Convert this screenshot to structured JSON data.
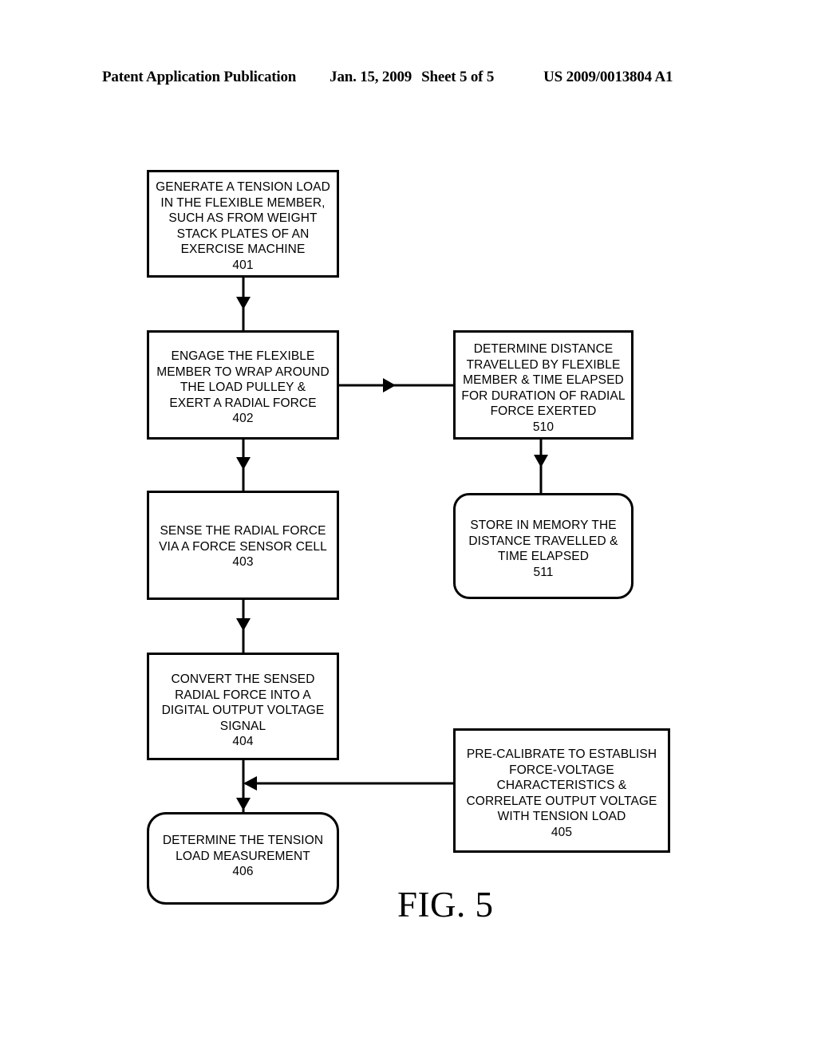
{
  "header": {
    "publication": "Patent Application Publication",
    "date": "Jan. 15, 2009",
    "sheet": "Sheet 5 of 5",
    "patent_number": "US 2009/0013804 A1"
  },
  "figure": {
    "caption": "FIG. 5"
  },
  "flowchart": {
    "boxes": [
      {
        "id": "401",
        "shape": "rectangle",
        "text": "GENERATE A TENSION LOAD\nIN THE FLEXIBLE MEMBER,\nSUCH AS FROM WEIGHT\nSTACK PLATES OF AN\nEXERCISE MACHINE\n401"
      },
      {
        "id": "402",
        "shape": "rectangle",
        "text": "ENGAGE THE FLEXIBLE\nMEMBER TO WRAP AROUND\nTHE LOAD PULLEY &\nEXERT A RADIAL FORCE\n402"
      },
      {
        "id": "510",
        "shape": "rectangle",
        "text": "DETERMINE DISTANCE\nTRAVELLED BY FLEXIBLE\nMEMBER & TIME ELAPSED\nFOR DURATION OF RADIAL\nFORCE EXERTED\n510"
      },
      {
        "id": "403",
        "shape": "rectangle",
        "text": "SENSE THE RADIAL FORCE\nVIA A FORCE SENSOR CELL\n403"
      },
      {
        "id": "511",
        "shape": "rounded-rectangle",
        "text": "STORE IN MEMORY THE\nDISTANCE TRAVELLED &\nTIME ELAPSED\n511"
      },
      {
        "id": "404",
        "shape": "rectangle",
        "text": "CONVERT THE SENSED\nRADIAL FORCE INTO A\nDIGITAL OUTPUT VOLTAGE\nSIGNAL\n404"
      },
      {
        "id": "405",
        "shape": "rectangle",
        "text": "PRE-CALIBRATE TO ESTABLISH\nFORCE-VOLTAGE\nCHARACTERISTICS &\nCORRELATE OUTPUT VOLTAGE\nWITH TENSION LOAD\n405"
      },
      {
        "id": "406",
        "shape": "rounded-rectangle",
        "text": "DETERMINE THE TENSION\nLOAD MEASUREMENT\n406"
      }
    ],
    "connectors": [
      {
        "from": "401",
        "to": "402",
        "direction": "down"
      },
      {
        "from": "402",
        "to": "510",
        "direction": "right"
      },
      {
        "from": "402",
        "to": "403",
        "direction": "down"
      },
      {
        "from": "510",
        "to": "511",
        "direction": "down"
      },
      {
        "from": "403",
        "to": "404",
        "direction": "down"
      },
      {
        "from": "405",
        "to": "404",
        "direction": "left"
      },
      {
        "from": "404",
        "to": "406",
        "direction": "down"
      }
    ]
  },
  "colors": {
    "ink": "#000000",
    "paper": "#ffffff"
  }
}
